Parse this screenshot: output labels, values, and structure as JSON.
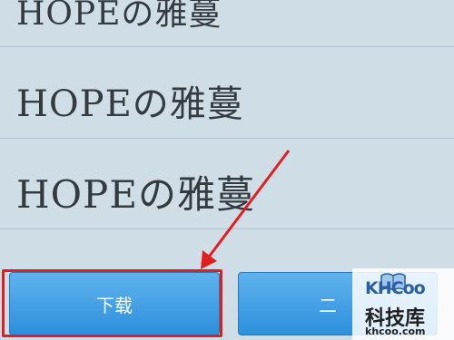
{
  "font_list": {
    "items": [
      {
        "label": "HOPEの雅蔓"
      },
      {
        "label": "HOPEの雅蔓"
      },
      {
        "label": "HOPEの雅蔓"
      }
    ]
  },
  "buttons": {
    "download_label": "下载",
    "second_label": "二"
  },
  "colors": {
    "button_blue": "#3a9be3",
    "highlight_red": "#e02020",
    "list_background": "#cfdde6"
  },
  "watermark": {
    "brand": "KHCoo",
    "chinese": "科技库",
    "url": "khcoo.com"
  }
}
